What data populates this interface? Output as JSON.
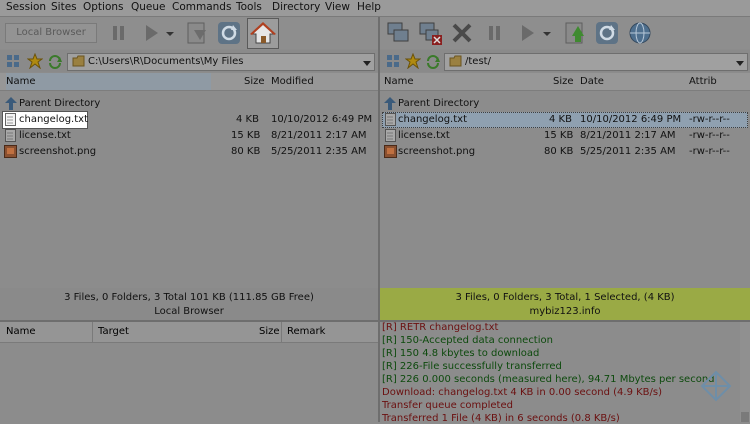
{
  "menu": [
    "Session",
    "Sites",
    "Options",
    "Queue",
    "Commands",
    "Tools",
    "Directory",
    "View",
    "Help"
  ],
  "left_toolbar": {
    "local_browser_label": "Local Browser"
  },
  "left_address": {
    "path": "C:\\Users\\R\\Documents\\My Files"
  },
  "right_address": {
    "path": "/test/"
  },
  "left_columns": {
    "name": "Name",
    "size": "Size",
    "modified": "Modified"
  },
  "right_columns": {
    "name": "Name",
    "size": "Size",
    "date": "Date",
    "attrib": "Attrib"
  },
  "parent_dir": "Parent Directory",
  "left_files": [
    {
      "name": "changelog.txt",
      "size": "4 KB",
      "modified": "10/10/2012 6:49 PM"
    },
    {
      "name": "license.txt",
      "size": "15 KB",
      "modified": "8/21/2011 2:17 AM"
    },
    {
      "name": "screenshot.png",
      "size": "80 KB",
      "modified": "5/25/2011 2:35 AM"
    }
  ],
  "right_files": [
    {
      "name": "changelog.txt",
      "size": "4 KB",
      "date": "10/10/2012 6:49 PM",
      "attrib": "-rw-r--r--"
    },
    {
      "name": "license.txt",
      "size": "15 KB",
      "date": "8/21/2011 2:17 AM",
      "attrib": "-rw-r--r--"
    },
    {
      "name": "screenshot.png",
      "size": "80 KB",
      "date": "5/25/2011 2:35 AM",
      "attrib": "-rw-r--r--"
    }
  ],
  "left_status": {
    "summary": "3 Files, 0 Folders, 3 Total 101 KB (111.85 GB Free)",
    "label": "Local Browser"
  },
  "right_status": {
    "summary": "3 Files, 0 Folders, 3 Total, 1 Selected, (4 KB)",
    "label": "mybiz123.info"
  },
  "queue_columns": {
    "name": "Name",
    "target": "Target",
    "size": "Size",
    "remark": "Remark"
  },
  "log": [
    {
      "text": "[R] RETR changelog.txt",
      "color": "#6b1010"
    },
    {
      "text": "[R] 150-Accepted data connection",
      "color": "#0d4a0d"
    },
    {
      "text": "[R] 150 4.8 kbytes to download",
      "color": "#0d4a0d"
    },
    {
      "text": "[R] 226-File successfully transferred",
      "color": "#0d4a0d"
    },
    {
      "text": "[R] 226 0.000 seconds (measured here), 94.71 Mbytes per second",
      "color": "#0d4a0d"
    },
    {
      "text": "Download: changelog.txt 4 KB in 0.00 second (4.9 KB/s)",
      "color": "#6b1010"
    },
    {
      "text": "Transfer queue completed",
      "color": "#6b1010"
    },
    {
      "text": "Transferred 1 File (4 KB) in 6 seconds (0.8 KB/s)",
      "color": "#6b1010"
    }
  ],
  "colors": {
    "selected_row": "#8fa0b0",
    "remote_status_bg": "#9aaa45",
    "highlight_bg": "#ffffff"
  }
}
